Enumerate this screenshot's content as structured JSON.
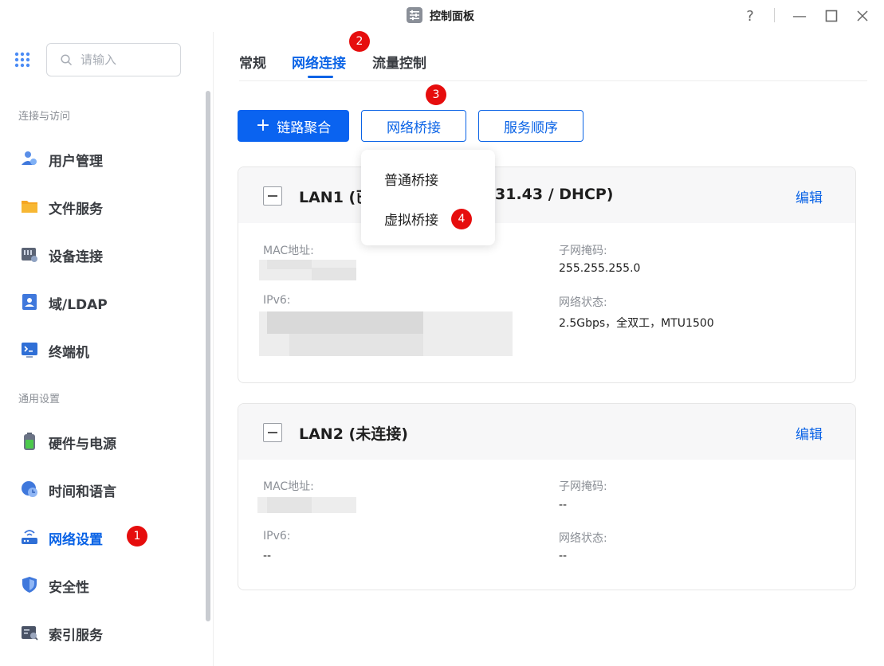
{
  "window": {
    "title": "控制面板",
    "help": "?",
    "minimize": "—",
    "maximize": "☐",
    "close": "✕"
  },
  "sidebar": {
    "search_placeholder": "请输入",
    "sections": [
      {
        "label": "连接与访问"
      },
      {
        "label": "通用设置"
      }
    ],
    "items": [
      {
        "label": "用户管理",
        "icon": "user-management-icon"
      },
      {
        "label": "文件服务",
        "icon": "folder-icon"
      },
      {
        "label": "设备连接",
        "icon": "device-connection-icon"
      },
      {
        "label": "域/LDAP",
        "icon": "domain-ldap-icon"
      },
      {
        "label": "终端机",
        "icon": "terminal-icon"
      },
      {
        "label": "硬件与电源",
        "icon": "battery-icon"
      },
      {
        "label": "时间和语言",
        "icon": "clock-globe-icon"
      },
      {
        "label": "网络设置",
        "icon": "network-router-icon",
        "active": true
      },
      {
        "label": "安全性",
        "icon": "shield-icon"
      },
      {
        "label": "索引服务",
        "icon": "index-service-icon"
      }
    ]
  },
  "tabs": [
    {
      "label": "常规"
    },
    {
      "label": "网络连接",
      "active": true
    },
    {
      "label": "流量控制"
    }
  ],
  "toolbar": {
    "link_aggregation": "链路聚合",
    "network_bridge": "网络桥接",
    "service_order": "服务顺序"
  },
  "dropdown": {
    "items": [
      {
        "label": "普通桥接"
      },
      {
        "label": "虚拟桥接"
      }
    ]
  },
  "badges": {
    "b1": "1",
    "b2": "2",
    "b3": "3",
    "b4": "4"
  },
  "lan1": {
    "title_left": "LAN1 (已",
    "title_right": "31.43 / DHCP)",
    "edit": "编辑",
    "mac_label": "MAC地址:",
    "ipv6_label": "IPv6:",
    "subnet_label": "子网掩码:",
    "subnet_value": "255.255.255.0",
    "status_label": "网络状态:",
    "status_value": "2.5Gbps，全双工，MTU1500"
  },
  "lan2": {
    "title": "LAN2 (未连接)",
    "edit": "编辑",
    "mac_label": "MAC地址:",
    "ipv6_label": "IPv6:",
    "ipv6_value": "--",
    "subnet_label": "子网掩码:",
    "subnet_value": "--",
    "status_label": "网络状态:",
    "status_value": "--"
  },
  "colors": {
    "accent": "#0a63e6",
    "badge": "#e60d0d"
  }
}
